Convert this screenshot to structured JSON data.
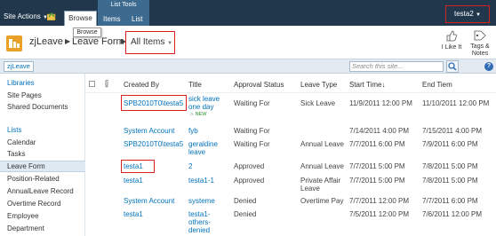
{
  "ribbon": {
    "site_actions_label": "Site Actions",
    "browse_tab": "Browse",
    "list_tools_label": "List Tools",
    "items_tab": "Items",
    "list_tab": "List",
    "user_name": "testa2",
    "tooltip": "Browse"
  },
  "title_bar": {
    "site_name": "zjLeave",
    "list_name": "Leave Form",
    "view_name": "All Items",
    "i_like_it": "I Like It",
    "tags_notes": "Tags & Notes"
  },
  "top_nav": {
    "home_tab": "zjLeave",
    "search_placeholder": "Search this site..."
  },
  "left_nav": {
    "libraries_heading": "Libraries",
    "site_pages": "Site Pages",
    "shared_documents": "Shared Documents",
    "lists_heading": "Lists",
    "calendar": "Calendar",
    "tasks": "Tasks",
    "leave_form": "Leave Form",
    "position_related": "Position-Related",
    "annualleave_record": "AnnualLeave Record",
    "overtime_record": "Overtime Record",
    "employee": "Employee",
    "department": "Department"
  },
  "list_view": {
    "columns": {
      "created_by": "Created By",
      "title": "Title",
      "approval_status": "Approval Status",
      "leave_type": "Leave Type",
      "start_time": "Start Time",
      "end_time": "End Tiem"
    },
    "sort_indicator": "↓",
    "new_badge": "NEW",
    "rows": [
      {
        "created_by": "SPB2010T0\\testa5",
        "title_line1": "sick leave",
        "title_line2": "one day",
        "status": "Waiting For",
        "leave_type": "Sick Leave",
        "start": "11/9/2011 12:00 PM",
        "end": "11/10/2011 12:00 PM"
      },
      {
        "created_by": "System Account",
        "title_line1": "fyb",
        "title_line2": "",
        "status": "Waiting For",
        "leave_type": "",
        "start": "7/14/2011 4:00 PM",
        "end": "7/15/2011 4:00 PM"
      },
      {
        "created_by": "SPB2010T0\\testa5",
        "title_line1": "geraldine",
        "title_line2": "leave",
        "status": "Waiting For",
        "leave_type": "Annual Leave",
        "start": "7/7/2011 6:00 PM",
        "end": "7/9/2011 6:00 PM"
      },
      {
        "created_by": "testa1",
        "title_line1": "2",
        "title_line2": "",
        "status": "Approved",
        "leave_type": "Annual Leave",
        "start": "7/7/2011 5:00 PM",
        "end": "7/8/2011 5:00 PM"
      },
      {
        "created_by": "testa1",
        "title_line1": "testa1-1",
        "title_line2": "",
        "status": "Approved",
        "leave_type": "Private Affair",
        "leave_type_line2": "Leave",
        "start": "7/7/2011 5:00 PM",
        "end": "7/8/2011 5:00 PM"
      },
      {
        "created_by": "System Account",
        "title_line1": "systeme",
        "title_line2": "",
        "status": "Denied",
        "leave_type": "Overtime Pay",
        "start": "7/7/2011 12:00 PM",
        "end": "7/7/2011 6:00 PM"
      },
      {
        "created_by": "testa1",
        "title_line1": "testa1-",
        "title_line2": "others-",
        "title_line3": "denied",
        "status": "Denied",
        "leave_type": "",
        "start": "7/5/2011 12:00 PM",
        "end": "7/6/2011 12:00 PM"
      }
    ]
  },
  "colors": {
    "ribbon": "#21374c",
    "list_tools": "#3d6a8f",
    "link": "#0072bc",
    "highlight_box": "#d72121"
  }
}
